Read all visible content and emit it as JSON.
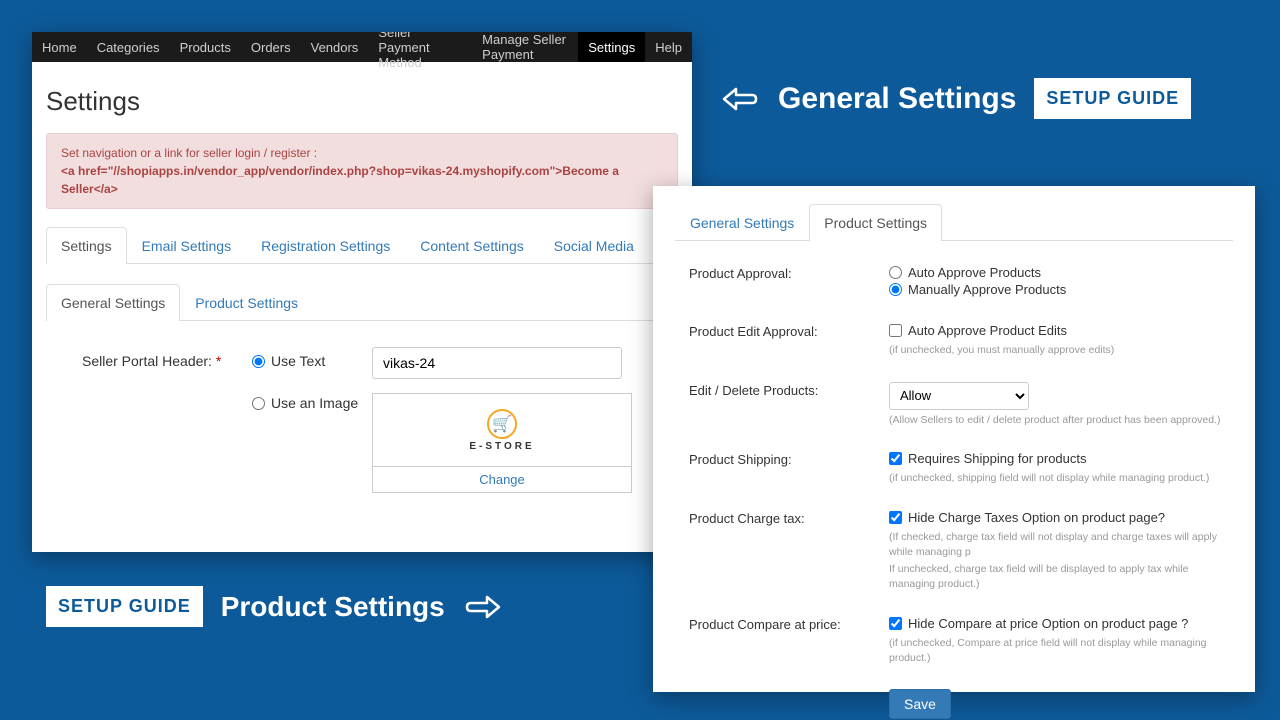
{
  "nav": {
    "items": [
      "Home",
      "Categories",
      "Products",
      "Orders",
      "Vendors",
      "Seller Payment Method",
      "Manage Seller Payment",
      "Settings",
      "Help"
    ],
    "active_index": 7
  },
  "page_title": "Settings",
  "alert": {
    "line1": "Set navigation or a link for seller login / register :",
    "line2": "<a href=\"//shopiapps.in/vendor_app/vendor/index.php?shop=vikas-24.myshopify.com\">Become a Seller</a>"
  },
  "main_tabs": [
    "Settings",
    "Email Settings",
    "Registration Settings",
    "Content Settings",
    "Social Media"
  ],
  "main_tabs_active": 0,
  "inner_tabs": [
    "General Settings",
    "Product Settings"
  ],
  "inner_tabs_active": 0,
  "general_form": {
    "header_label": "Seller Portal Header:",
    "opt_text": "Use Text",
    "opt_img": "Use an Image",
    "header_value": "vikas-24",
    "estore_label": "E-STORE",
    "change_link": "Change"
  },
  "card2_tabs": [
    "General Settings",
    "Product Settings"
  ],
  "card2_tabs_active": 1,
  "product_form": {
    "approval_label": "Product Approval:",
    "approval_auto": "Auto Approve Products",
    "approval_manual": "Manually Approve Products",
    "edit_approval_label": "Product Edit Approval:",
    "edit_approval_chk": "Auto Approve Product Edits",
    "edit_approval_hint": "(if unchecked, you must manually approve edits)",
    "edit_delete_label": "Edit / Delete Products:",
    "edit_delete_value": "Allow",
    "edit_delete_hint": "(Allow Sellers to edit / delete product after product has been approved.)",
    "shipping_label": "Product Shipping:",
    "shipping_chk": "Requires Shipping for products",
    "shipping_hint": "(if unchecked, shipping field will not display while managing product.)",
    "tax_label": "Product Charge tax:",
    "tax_chk": "Hide Charge Taxes Option on product page?",
    "tax_hint1": "(If checked, charge tax field will not display and charge taxes will apply while managing p",
    "tax_hint2": "If unchecked, charge tax field will be displayed to apply tax while managing product.)",
    "compare_label": "Product Compare at price:",
    "compare_chk": "Hide Compare at price Option on product page ?",
    "compare_hint": "(if unchecked, Compare at price field will not display while managing product.)",
    "save": "Save"
  },
  "banners": {
    "general": "General Settings",
    "product": "Product Settings",
    "guide": "SETUP GUIDE"
  }
}
